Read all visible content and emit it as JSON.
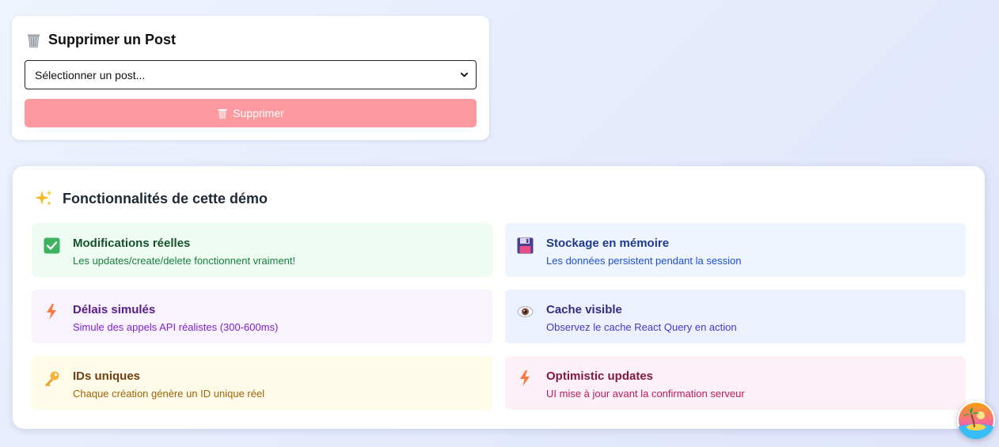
{
  "delete_panel": {
    "title": "Supprimer un Post",
    "select_value": "Sélectionner un post...",
    "button_label": "Supprimer",
    "button_color": "#fc9a9f"
  },
  "features": {
    "title": "Fonctionnalités de cette démo",
    "items": [
      {
        "icon": "check-box-icon",
        "title": "Modifications réelles",
        "description": "Les updates/create/delete fonctionnent vraiment!"
      },
      {
        "icon": "floppy-disk-icon",
        "title": "Stockage en mémoire",
        "description": "Les données persistent pendant la session"
      },
      {
        "icon": "lightning-icon",
        "title": "Délais simulés",
        "description": "Simule des appels API réalistes (300-600ms)"
      },
      {
        "icon": "eye-icon",
        "title": "Cache visible",
        "description": "Observez le cache React Query en action"
      },
      {
        "icon": "key-icon",
        "title": "IDs uniques",
        "description": "Chaque création génère un ID unique réel"
      },
      {
        "icon": "lightning-icon",
        "title": "Optimistic updates",
        "description": "UI mise à jour avant la confirmation serveur"
      }
    ]
  },
  "floating_button": {
    "icon": "tropical-island-icon"
  }
}
